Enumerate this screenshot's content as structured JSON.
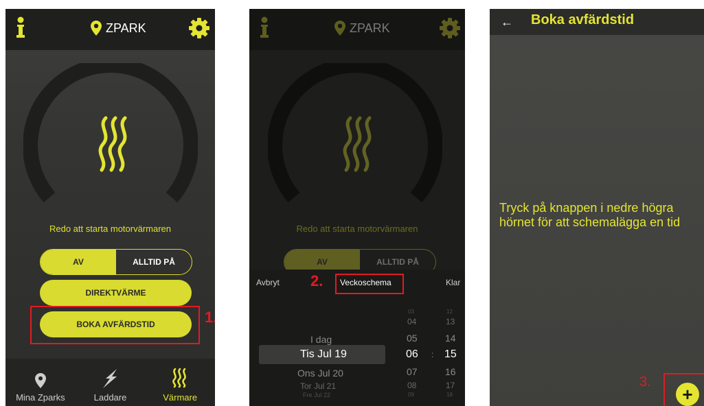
{
  "colors": {
    "accent": "#e3e532",
    "annotation_red": "#e21b22",
    "background": "#2f2f2d"
  },
  "screen1": {
    "location_name": "ZPARK",
    "status_text": "Redo att starta motorvärmaren",
    "toggle": {
      "left_label": "AV",
      "right_label": "ALLTID PÅ",
      "selected": "AV"
    },
    "direct_button": "DIREKTVÄRME",
    "book_button": "BOKA AVFÄRDSTID",
    "step_label": "1.",
    "nav": [
      {
        "label": "Mina Zparks",
        "icon": "location-pin-icon"
      },
      {
        "label": "Laddare",
        "icon": "lightning-icon"
      },
      {
        "label": "Värmare",
        "icon": "heater-icon",
        "active": true
      }
    ]
  },
  "screen2": {
    "location_name": "ZPARK",
    "status_text": "Redo att starta motorvärmaren",
    "toggle": {
      "left_label": "AV",
      "right_label": "ALLTID PÅ"
    },
    "picker": {
      "cancel": "Avbryt",
      "weekly": "Veckoschema",
      "done": "Klar",
      "step_label": "2.",
      "days": [
        "I dag",
        "Tis Jul 19",
        "Ons Jul 20",
        "Tor Jul 21",
        "Fre Jul 22"
      ],
      "hours": [
        "03",
        "04",
        "05",
        "06",
        "07",
        "08",
        "09"
      ],
      "minutes": [
        "12",
        "13",
        "14",
        "15",
        "16",
        "17",
        "18"
      ],
      "separator": ":"
    }
  },
  "screen3": {
    "back": "←",
    "title": "Boka avfärdstid",
    "message": "Tryck på knappen i nedre högra hörnet för att schemalägga en tid",
    "fab": "+",
    "step_label": "3."
  }
}
